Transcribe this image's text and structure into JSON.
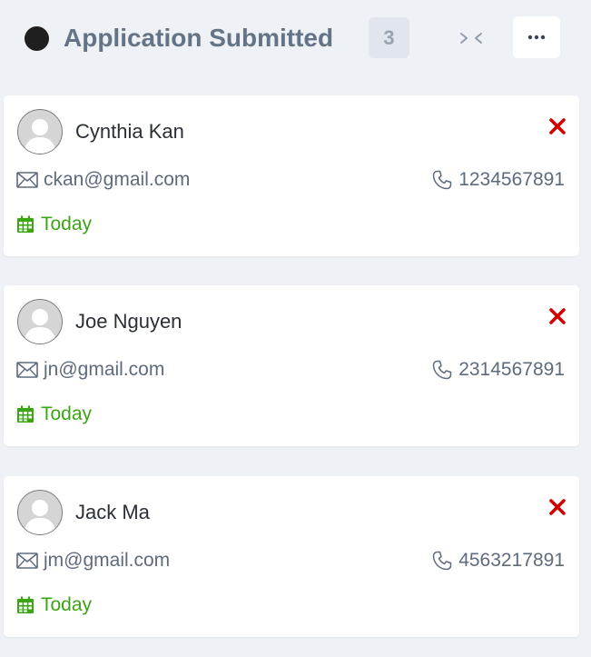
{
  "column": {
    "title": "Application Submitted",
    "count": "3",
    "collapse_icon": "collapse-arrows-icon",
    "more_icon": "ellipsis-icon",
    "dot_color": "#1f1f1f"
  },
  "colors": {
    "remove": "#d10000",
    "date": "#3ba513",
    "muted_text": "#5e6b7c"
  },
  "cards": [
    {
      "name": "Cynthia Kan",
      "email": "ckan@gmail.com",
      "phone": "1234567891",
      "date": "Today"
    },
    {
      "name": "Joe Nguyen",
      "email": "jn@gmail.com",
      "phone": "2314567891",
      "date": "Today"
    },
    {
      "name": "Jack Ma",
      "email": "jm@gmail.com",
      "phone": "4563217891",
      "date": "Today"
    }
  ]
}
